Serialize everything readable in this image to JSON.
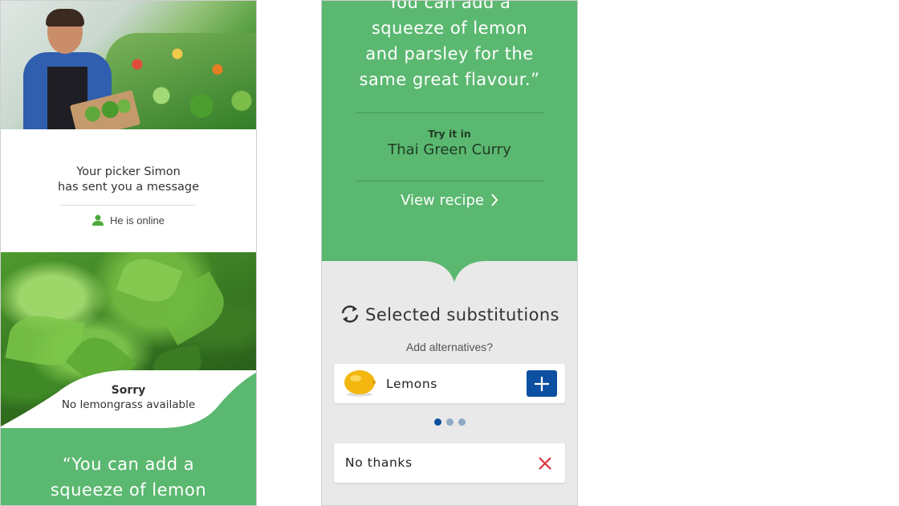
{
  "left_panel": {
    "picker_message": "Your picker Simon\nhas sent you a message",
    "online_status": "He is online",
    "sorry_title": "Sorry",
    "sorry_subtitle": "No lemongrass available",
    "quote": "“You can add a\nsqueeze of lemon"
  },
  "right_panel": {
    "quote": "You can add a\nsqueeze of lemon\nand parsley for the\nsame great flavour.”",
    "try_label": "Try it in",
    "recipe_name": "Thai Green Curry",
    "view_recipe": "View recipe",
    "subs_title": "Selected substitutions",
    "add_alternatives": "Add alternatives?",
    "alternative": {
      "label": "Lemons",
      "icon": "lemon-icon"
    },
    "pagination": {
      "total": 3,
      "active_index": 0
    },
    "no_thanks": "No thanks"
  },
  "colors": {
    "brand_green": "#5bb870",
    "brand_blue": "#0d4fa0",
    "close_red": "#d9333f",
    "online_green": "#4caa3c"
  }
}
